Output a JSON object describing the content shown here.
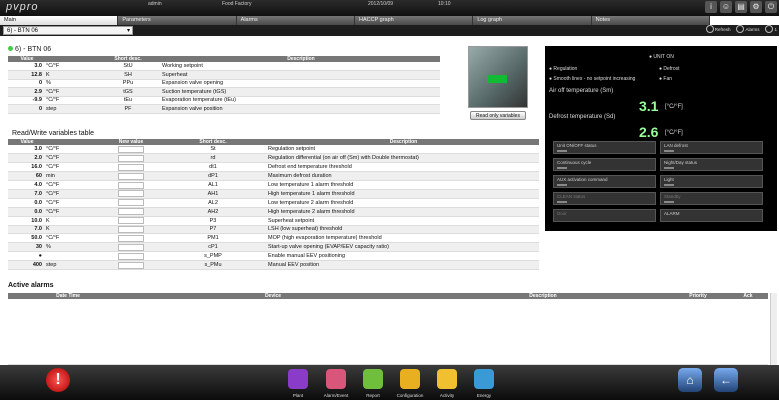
{
  "topbar": {
    "user": "admin",
    "site": "Food Factory",
    "date": "2012/10/09",
    "time": "10:10",
    "logo": "pvpro"
  },
  "tabs": [
    "Main",
    "Parameters",
    "Alarms",
    "HACCP graph",
    "Log graph",
    "Notes"
  ],
  "toolbar": {
    "refresh": "Refresh",
    "alarms": "Alarms",
    "extra": "1"
  },
  "device": {
    "selector": "6) - BTN 06",
    "title": "6) - BTN 06"
  },
  "readonly": {
    "headers": [
      "Value",
      "",
      "Short desc.",
      "Description"
    ],
    "rows": [
      [
        "3.0",
        "°C/°F",
        "StU",
        "Working setpoint"
      ],
      [
        "12.8",
        "K",
        "SH",
        "Superheat"
      ],
      [
        "0",
        "%",
        "PPu",
        "Expansion valve opening"
      ],
      [
        "2.9",
        "°C/°F",
        "tGS",
        "Suction temperature (tGS)"
      ],
      [
        "-9.9",
        "°C/°F",
        "tEu",
        "Evaporation temperature (tEu)"
      ],
      [
        "0",
        "step",
        "PF",
        "Expansion valve position"
      ]
    ]
  },
  "rw": {
    "title": "Read/Write variables table",
    "headers": [
      "Value",
      "",
      "New value",
      "Short desc.",
      "Description"
    ],
    "rows": [
      [
        "3.0",
        "°C/°F",
        "St",
        "Regulation setpoint"
      ],
      [
        "2.0",
        "°C/°F",
        "rd",
        "Regulation differential (on air off (Sm) with Double thermostat)"
      ],
      [
        "16.0",
        "°C/°F",
        "dt1",
        "Defrost end temperature threshold"
      ],
      [
        "60",
        "min",
        "dP1",
        "Maximum defrost duration"
      ],
      [
        "4.0",
        "°C/°F",
        "AL1",
        "Low temperature 1 alarm threshold"
      ],
      [
        "7.0",
        "°C/°F",
        "AH1",
        "High temperature 1 alarm threshold"
      ],
      [
        "0.0",
        "°C/°F",
        "AL2",
        "Low temperature 2 alarm threshold"
      ],
      [
        "0.0",
        "°C/°F",
        "AH2",
        "High temperature 2 alarm threshold"
      ],
      [
        "10.0",
        "K",
        "P3",
        "Superheat setpoint"
      ],
      [
        "7.0",
        "K",
        "P7",
        "LSH (low superheat) threshold"
      ],
      [
        "50.0",
        "°C/°F",
        "PM1",
        "MOP (high evaporation temperature) threshold"
      ],
      [
        "30",
        "%",
        "cP1",
        "Start-up valve opening (EVAP/EEV capacity ratio)"
      ],
      [
        "●",
        "",
        "s_PMP",
        "Enable manual EEV positioning"
      ],
      [
        "400",
        "step",
        "s_PMu",
        "Manual EEV position"
      ]
    ]
  },
  "readbtn": "Read only variables",
  "panel": {
    "unit_on": "UNIT ON",
    "regulation": "Regulation",
    "defrost": "Defrost",
    "smooth": "Smooth lines - no setpoint increasing",
    "fan": "Fan",
    "airoff_label": "Air off temperature (Sm)",
    "airoff_value": "3.1",
    "airoff_unit": "[°C/°F]",
    "defrost_label": "Defrost temperature (Sd)",
    "defrost_value": "2.6",
    "defrost_unit": "[°C/°F]",
    "buttons": [
      "Unit ON/OFF status",
      "LAN defrost",
      "Continuous cycle",
      "Night/Day status",
      "AUX activation command",
      "Light",
      "CLEAN status",
      "Standby",
      "Door",
      "ALARM"
    ]
  },
  "alarms": {
    "title": "Active alarms",
    "headers": [
      "Date Time",
      "Device",
      "Description",
      "Priority",
      "Ack"
    ]
  },
  "bottom": {
    "items": [
      "Plant",
      "Alarm/Event",
      "Report",
      "Configuration",
      "Activity",
      "Energy"
    ],
    "colors": [
      "#8a3cc8",
      "#d8567a",
      "#6fbf3c",
      "#e8b020",
      "#f0c030",
      "#3a9ad6"
    ]
  }
}
